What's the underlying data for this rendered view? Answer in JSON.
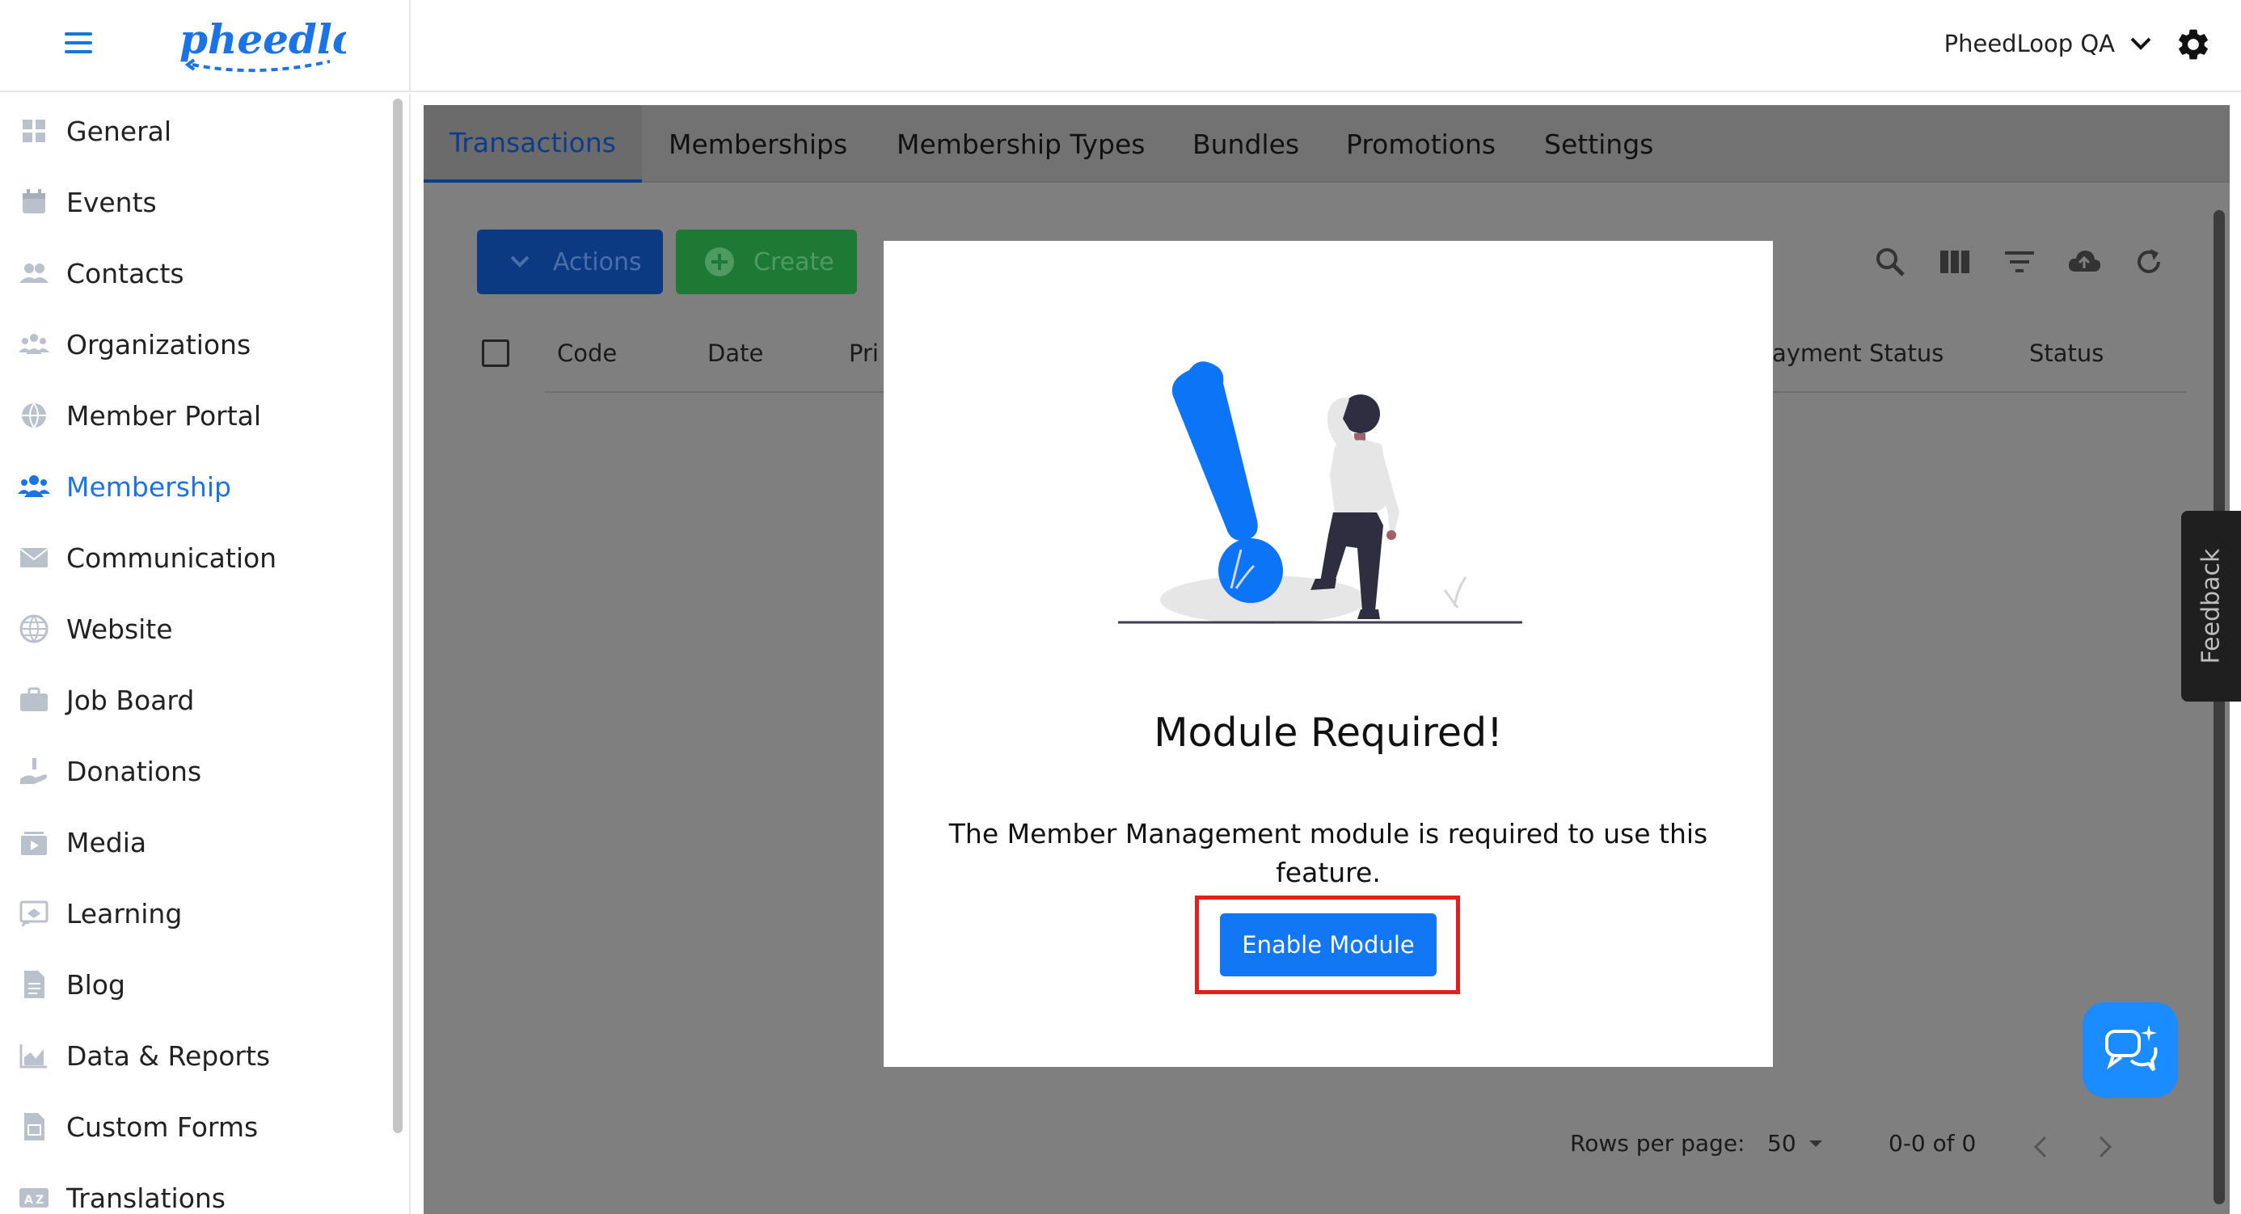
{
  "header": {
    "logo_text": "pheedloop",
    "account_name": "PheedLoop QA"
  },
  "sidebar": {
    "items": [
      {
        "label": "General"
      },
      {
        "label": "Events"
      },
      {
        "label": "Contacts"
      },
      {
        "label": "Organizations"
      },
      {
        "label": "Member Portal"
      },
      {
        "label": "Membership"
      },
      {
        "label": "Communication"
      },
      {
        "label": "Website"
      },
      {
        "label": "Job Board"
      },
      {
        "label": "Donations"
      },
      {
        "label": "Media"
      },
      {
        "label": "Learning"
      },
      {
        "label": "Blog"
      },
      {
        "label": "Data & Reports"
      },
      {
        "label": "Custom Forms"
      },
      {
        "label": "Translations"
      }
    ],
    "active_index": 5
  },
  "tabs": [
    "Transactions",
    "Memberships",
    "Membership Types",
    "Bundles",
    "Promotions",
    "Settings"
  ],
  "toolbar": {
    "actions_label": "Actions",
    "create_label": "Create"
  },
  "table": {
    "columns_left": [
      "Code",
      "Date",
      "Pri"
    ],
    "columns_right": [
      "ayment Status",
      "Status"
    ]
  },
  "pagination": {
    "rows_per_page_label": "Rows per page:",
    "rows_per_page_value": "50",
    "range": "0-0 of 0"
  },
  "modal": {
    "title": "Module Required!",
    "message": "The Member Management module is required to use this feature.",
    "button_label": "Enable Module"
  },
  "feedback_label": "Feedback",
  "colors": {
    "brand_blue": "#1177f5",
    "active_blue": "#1a73e8",
    "highlight_red": "#e51d1d"
  }
}
